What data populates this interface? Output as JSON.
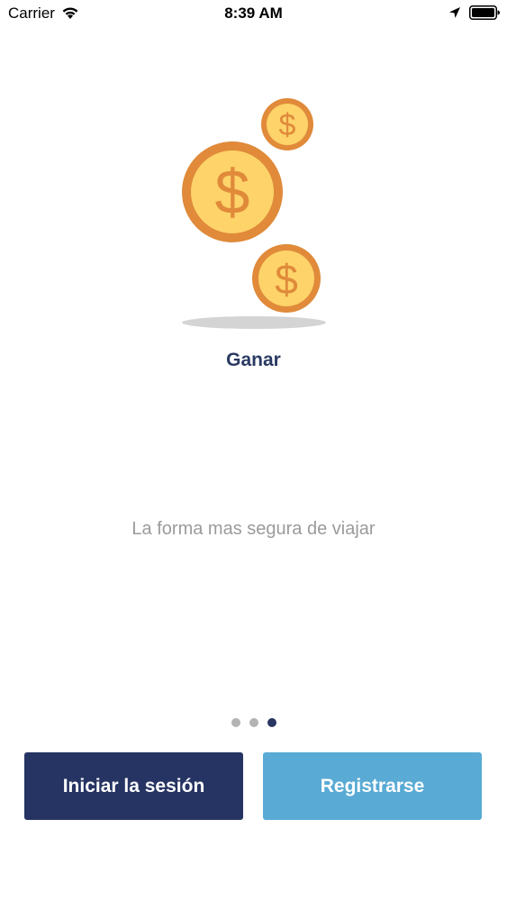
{
  "status_bar": {
    "carrier": "Carrier",
    "time": "8:39 AM"
  },
  "onboarding": {
    "title": "Ganar",
    "subtitle": "La forma mas segura de viajar",
    "page_count": 3,
    "current_page": 3
  },
  "buttons": {
    "login_label": "Iniciar la sesión",
    "register_label": "Registrarse"
  },
  "colors": {
    "primary_dark": "#263463",
    "primary_light": "#59aad4",
    "title_text": "#2a3a63",
    "coin_fill": "#fdd36a",
    "coin_border": "#e08a3a"
  }
}
